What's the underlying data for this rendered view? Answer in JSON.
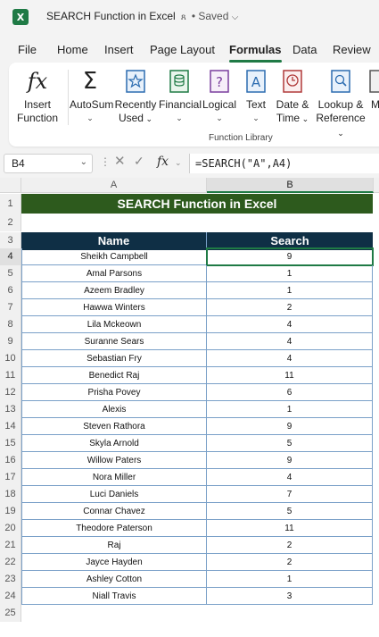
{
  "window": {
    "app_icon": "excel-logo-icon",
    "doc_title": "SEARCH Function in Excel",
    "saved_status": "• Saved",
    "chevron": "⌵"
  },
  "menu": {
    "tabs": [
      "File",
      "Home",
      "Insert",
      "Page Layout",
      "Formulas",
      "Data",
      "Review"
    ],
    "active": "Formulas"
  },
  "ribbon": {
    "insert_function": [
      "Insert",
      "Function"
    ],
    "autosum": "AutoSum",
    "recently_used": [
      "Recently",
      "Used"
    ],
    "financial": "Financial",
    "logical": "Logical",
    "text": "Text",
    "date_time": [
      "Date &",
      "Time"
    ],
    "lookup_reference": [
      "Lookup &",
      "Reference"
    ],
    "more": "M",
    "group_label": "Function Library"
  },
  "formula_bar": {
    "name_box": "B4",
    "fx": "fx",
    "formula": "=SEARCH(\"A\",A4)"
  },
  "sheet": {
    "columns": [
      "A",
      "B"
    ],
    "row_numbers": [
      1,
      2,
      3,
      4,
      5,
      6,
      7,
      8,
      9,
      10,
      11,
      12,
      13,
      14,
      15,
      16,
      17,
      18,
      19,
      20,
      21,
      22,
      23,
      24,
      25
    ],
    "title": "SEARCH Function in Excel",
    "headers": [
      "Name",
      "Search"
    ],
    "rows": [
      [
        "Sheikh Campbell",
        "9"
      ],
      [
        "Amal Parsons",
        "1"
      ],
      [
        "Azeem Bradley",
        "1"
      ],
      [
        "Hawwa Winters",
        "2"
      ],
      [
        "Lila Mckeown",
        "4"
      ],
      [
        "Suranne Sears",
        "4"
      ],
      [
        "Sebastian Fry",
        "4"
      ],
      [
        "Benedict Raj",
        "11"
      ],
      [
        "Prisha Povey",
        "6"
      ],
      [
        "Alexis",
        "1"
      ],
      [
        "Steven Rathora",
        "9"
      ],
      [
        "Skyla Arnold",
        "5"
      ],
      [
        "Willow Paters",
        "9"
      ],
      [
        "Nora Miller",
        "4"
      ],
      [
        "Luci Daniels",
        "7"
      ],
      [
        "Connar Chavez",
        "5"
      ],
      [
        "Theodore Paterson",
        "11"
      ],
      [
        "Raj",
        "2"
      ],
      [
        "Jayce Hayden",
        "2"
      ],
      [
        "Ashley Cotton",
        "1"
      ],
      [
        "Niall Travis",
        "3"
      ]
    ],
    "active_cell": "B4"
  },
  "colors": {
    "title_fill": "#2d5a1d",
    "header_fill": "#0f2f45",
    "accent": "#1f7a45"
  }
}
